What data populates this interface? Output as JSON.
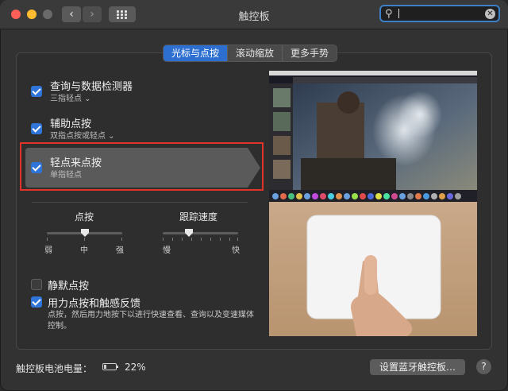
{
  "window": {
    "title": "触控板"
  },
  "search": {
    "value": "",
    "icon": "magnifier-icon",
    "clear_icon": "clear-icon"
  },
  "tabs": [
    {
      "label": "光标与点按",
      "active": true
    },
    {
      "label": "滚动缩放",
      "active": false
    },
    {
      "label": "更多手势",
      "active": false
    }
  ],
  "options": [
    {
      "label": "查询与数据检测器",
      "sub": "三指轻点 ⌄",
      "checked": true
    },
    {
      "label": "辅助点按",
      "sub": "双指点按或轻点 ⌄",
      "checked": true
    },
    {
      "label": "轻点来点按",
      "sub": "单指轻点",
      "checked": true
    }
  ],
  "sliders": {
    "click": {
      "label": "点按",
      "min": "弱",
      "mid": "中",
      "max": "强",
      "level": 0.5
    },
    "speed": {
      "label": "跟踪速度",
      "min": "慢",
      "max": "快",
      "level": 0.35
    }
  },
  "checkbox_options": [
    {
      "label": "静默点按",
      "checked": false
    },
    {
      "label": "用力点按和触感反馈",
      "checked": true
    }
  ],
  "force_desc": "点按，然后用力地按下以进行快速查看、查询以及变速媒体控制。",
  "footer": {
    "battery_label": "触控板电池电量：",
    "battery_percent": "22%",
    "battery_level": 0.22,
    "bluetooth_button": "设置蓝牙触控板…",
    "help": "?"
  },
  "colors": {
    "accent": "#2c6fd0",
    "highlight_border": "#e2332b"
  }
}
